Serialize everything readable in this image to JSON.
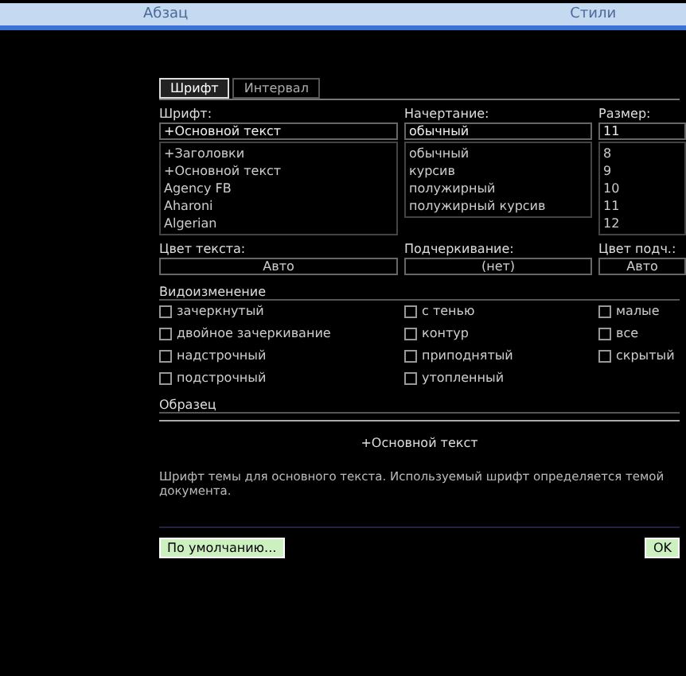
{
  "ribbon": {
    "groups": [
      "Абзац",
      "Стили"
    ]
  },
  "tabs": [
    {
      "label": "Шрифт",
      "selected": true
    },
    {
      "label": "Интервал",
      "selected": false
    }
  ],
  "font": {
    "label": "Шрифт:",
    "value": "+Основной текст",
    "items": [
      "+Заголовки",
      "+Основной текст",
      "Agency FB",
      "Aharoni",
      "Algerian"
    ]
  },
  "style": {
    "label": "Начертание:",
    "value": "обычный",
    "items": [
      "обычный",
      "курсив",
      "полужирный",
      "полужирный курсив"
    ]
  },
  "size": {
    "label": "Размер:",
    "value": "11",
    "items": [
      "8",
      "9",
      "10",
      "11",
      "12"
    ]
  },
  "text_color": {
    "label": "Цвет текста:",
    "value": "Авто"
  },
  "underline": {
    "label": "Подчеркивание:",
    "value": "(нет)"
  },
  "underline_color": {
    "label": "Цвет подч.:",
    "value": "Авто"
  },
  "effects": {
    "label": "Видоизменение",
    "columns": [
      [
        {
          "label": "зачеркнутый",
          "checked": false
        },
        {
          "label": "двойное зачеркивание",
          "checked": false
        },
        {
          "label": "надстрочный",
          "checked": false
        },
        {
          "label": "подстрочный",
          "checked": false
        }
      ],
      [
        {
          "label": "с тенью",
          "checked": false
        },
        {
          "label": "контур",
          "checked": false
        },
        {
          "label": "приподнятый",
          "checked": false
        },
        {
          "label": "утопленный",
          "checked": false
        }
      ],
      [
        {
          "label": "малые",
          "checked": false
        },
        {
          "label": "все",
          "checked": false
        },
        {
          "label": "скрытый",
          "checked": false
        }
      ]
    ]
  },
  "preview": {
    "label": "Образец",
    "sample": "+Основной текст",
    "note": "Шрифт темы для основного текста. Используемый шрифт определяется темой документа."
  },
  "buttons": [
    "По умолчанию...",
    "OK"
  ]
}
